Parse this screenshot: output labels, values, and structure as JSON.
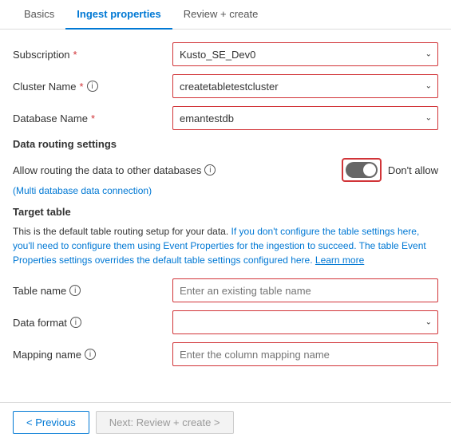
{
  "tabs": [
    {
      "id": "basics",
      "label": "Basics",
      "active": false
    },
    {
      "id": "ingest-properties",
      "label": "Ingest properties",
      "active": true
    },
    {
      "id": "review-create",
      "label": "Review + create",
      "active": false
    }
  ],
  "form": {
    "subscription_label": "Subscription",
    "subscription_required": "*",
    "subscription_value": "Kusto_SE_Dev0",
    "cluster_label": "Cluster Name",
    "cluster_required": "*",
    "cluster_value": "createtabletestcluster",
    "database_label": "Database Name",
    "database_required": "*",
    "database_value": "emantestdb",
    "data_routing_section": "Data routing settings",
    "routing_label": "Allow routing the data to other databases",
    "multi_db_note": "(Multi database data connection)",
    "dont_allow_text": "Don't allow",
    "target_table_title": "Target table",
    "description": "This is the default table routing setup for your data.",
    "description_blue": "If you don't configure the table settings here, you'll need to configure them using Event Properties for the ingestion to succeed. The table Event Properties settings overrides the default table settings configured here.",
    "learn_more": "Learn more",
    "table_name_label": "Table name",
    "table_name_placeholder": "Enter an existing table name",
    "data_format_label": "Data format",
    "data_format_placeholder": "",
    "mapping_name_label": "Mapping name",
    "mapping_name_placeholder": "Enter the column mapping name"
  },
  "footer": {
    "previous_label": "< Previous",
    "next_label": "Next: Review + create >"
  }
}
